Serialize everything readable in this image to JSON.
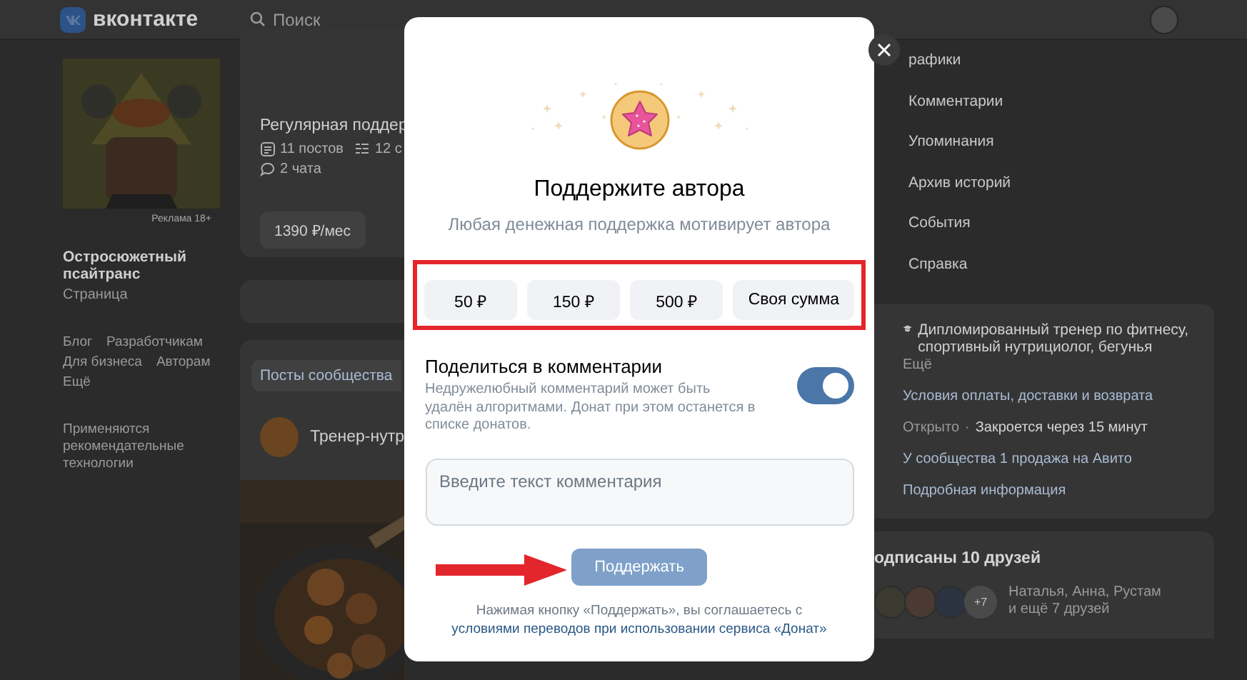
{
  "header": {
    "logo": "вконтакте",
    "search": {
      "placeholder": "Поиск"
    }
  },
  "left": {
    "ad_label": "Реклама 18+",
    "profile_name": "Остросюжетный псайтранс",
    "profile_type": "Страница",
    "footer_links": [
      "Блог",
      "Разработчикам",
      "Для бизнеса",
      "Авторам",
      "Ещё"
    ],
    "note": "Применяются рекомендательные технологии"
  },
  "donut_card": {
    "title": "Регулярная поддер",
    "stats": [
      {
        "kind": "posts",
        "text": "11 постов"
      },
      {
        "kind": "list",
        "text": "12 с"
      },
      {
        "kind": "chat",
        "text": "2 чата"
      }
    ],
    "price": "1390 ₽/мес"
  },
  "feed": {
    "tab": "Посты сообщества",
    "post_author": "Тренер-нутр"
  },
  "right_menu": [
    "рафики",
    "Комментарии",
    "Упоминания",
    "Архив историй",
    "События",
    "Справка"
  ],
  "info": {
    "description": "Дипломированный тренер по фитнесу, спортивный нутрициолог, бегунья",
    "more": "Ещё",
    "rows": [
      {
        "kind": "link",
        "text": "Условия оплаты, доставки и возврата"
      },
      {
        "kind": "hours",
        "status": "Открыто",
        "separator": "·",
        "text": "Закроется через 15 минут"
      },
      {
        "kind": "link",
        "text": "У сообщества 1 продажа на Авито"
      },
      {
        "kind": "link",
        "text": "Подробная информация"
      }
    ]
  },
  "friends": {
    "title": "одписаны 10 друзей",
    "avatars": [
      {
        "color": "#3b3a30"
      },
      {
        "color": "#4a3a32"
      },
      {
        "color": "#2c3340"
      }
    ],
    "more_count": "+7",
    "names": "Наталья, Анна, Рустам и ещё 7 друзей"
  },
  "modal": {
    "title": "Поддержите автора",
    "subtitle": "Любая денежная поддержка мотивирует автора",
    "amounts": [
      "50 ₽",
      "150 ₽",
      "500 ₽",
      "Своя сумма"
    ],
    "share": {
      "title": "Поделиться в комментарии",
      "description": "Недружелюбный комментарий может быть удалён алгоритмами. Донат при этом останется в списке донатов.",
      "on": true
    },
    "comment": {
      "placeholder": "Введите текст комментария"
    },
    "submit": {
      "label": "Поддержать",
      "disabled": true
    },
    "terms": {
      "text": "Нажимая кнопку «Поддержать», вы соглашаетесь с",
      "link": "условиями переводов при использовании сервиса «Донат»"
    }
  }
}
